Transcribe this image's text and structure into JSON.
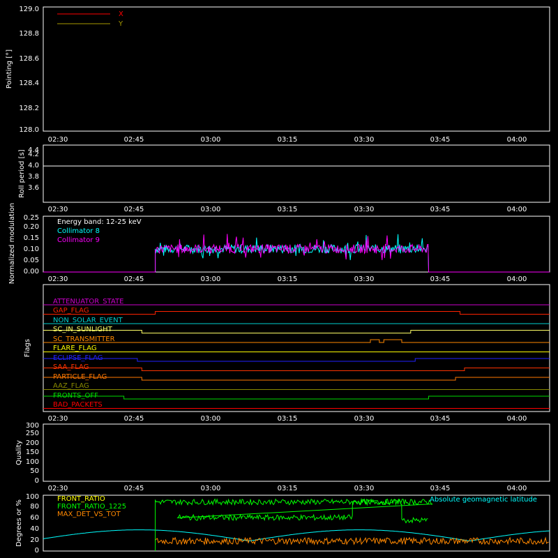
{
  "chart_data": [
    {
      "type": "line",
      "ylabel": "Pointing [°]",
      "ylim": [
        128.0,
        129.0
      ],
      "yticks": [
        "128.0",
        "128.2",
        "128.4",
        "128.6",
        "128.8",
        "129.0"
      ],
      "xticks": [
        "02:30",
        "02:45",
        "03:00",
        "03:15",
        "03:30",
        "03:45",
        "04:00"
      ],
      "legend": [
        {
          "name": "X",
          "color": "#ff0000"
        },
        {
          "name": "Y",
          "color": "#a89a00"
        }
      ],
      "series": []
    },
    {
      "type": "line",
      "ylabel": "Roll period [s]",
      "ylim": [
        3.5,
        4.5
      ],
      "yticks": [
        "3.6",
        "3.8",
        "4.0",
        "4.2",
        "4.4"
      ],
      "xticks": [
        "02:30",
        "02:45",
        "03:00",
        "03:15",
        "03:30",
        "03:45",
        "04:00"
      ],
      "series": [
        {
          "color": "#ffffff",
          "value": 4.12
        }
      ]
    },
    {
      "type": "line",
      "ylabel": "Normalized modulation",
      "ylim": [
        0.0,
        0.25
      ],
      "yticks": [
        "0.00",
        "0.05",
        "0.10",
        "0.15",
        "0.20",
        "0.25"
      ],
      "xticks": [
        "02:30",
        "02:45",
        "03:00",
        "03:15",
        "03:30",
        "03:45",
        "04:00"
      ],
      "annotations": [
        "Energy band: 12-25 keV"
      ],
      "legend": [
        {
          "name": "Collimator 8",
          "color": "#00ffff"
        },
        {
          "name": "Collimator 9",
          "color": "#ff00ff"
        }
      ],
      "active_window": [
        "02:47",
        "03:48"
      ],
      "baseline": 0.1
    },
    {
      "type": "line",
      "ylabel": "Flags",
      "xticks": [
        "02:30",
        "02:45",
        "03:00",
        "03:15",
        "03:30",
        "03:45",
        "04:00"
      ],
      "flags": [
        {
          "name": "ATTENUATOR_STATE",
          "color": "#cc00cc"
        },
        {
          "name": "GAP_FLAG",
          "color": "#ff2200"
        },
        {
          "name": "NON_SOLAR_EVENT",
          "color": "#00d0d0"
        },
        {
          "name": "SC_IN_SUNLIGHT",
          "color": "#ffff66"
        },
        {
          "name": "SC_TRANSMITTER",
          "color": "#ff8800"
        },
        {
          "name": "FLARE_FLAG",
          "color": "#ffff00"
        },
        {
          "name": "ECLIPSE_FLAG",
          "color": "#2222ff"
        },
        {
          "name": "SAA_FLAG",
          "color": "#ff3300"
        },
        {
          "name": "PARTICLE_FLAG",
          "color": "#ff7700"
        },
        {
          "name": "AAZ_FLAG",
          "color": "#888800"
        },
        {
          "name": "FRONTS_OFF",
          "color": "#00dd00"
        },
        {
          "name": "BAD_PACKETS",
          "color": "#ff0000"
        }
      ]
    },
    {
      "type": "line",
      "ylabel": "Quality",
      "ylim": [
        0,
        300
      ],
      "yticks": [
        "0",
        "50",
        "100",
        "150",
        "200",
        "250",
        "300"
      ],
      "xticks": [
        "02:30",
        "02:45",
        "03:00",
        "03:15",
        "03:30",
        "03:45",
        "04:00"
      ],
      "series": []
    },
    {
      "type": "line",
      "ylabel": "Degrees or %",
      "ylim": [
        0,
        100
      ],
      "yticks": [
        "0",
        "20",
        "40",
        "60",
        "80",
        "100"
      ],
      "legend": [
        {
          "name": "FRONT_RATIO",
          "color": "#ffff00"
        },
        {
          "name": "FRONT_RATIO_1225",
          "color": "#00ff00"
        },
        {
          "name": "MAX_DET_VS_TOT",
          "color": "#ff8800"
        },
        {
          "name": "Absolute geomagnetic latitude",
          "color": "#00ffff"
        }
      ],
      "series": [
        {
          "name": "FRONT_RATIO_1225",
          "color": "#00ff00",
          "segments": [
            [
              "02:47",
              "03:49",
              88,
              "02:52"
            ],
            [
              "02:52",
              "03:31",
              60,
              null
            ],
            [
              "03:31",
              "03:42",
              88,
              null
            ],
            [
              "03:42",
              "03:48",
              55,
              null
            ]
          ]
        },
        {
          "name": "MAX_DET_VS_TOT",
          "color": "#ff8800",
          "level": 18
        },
        {
          "name": "Absolute geomagnetic latitude",
          "color": "#00ffff"
        }
      ]
    }
  ]
}
